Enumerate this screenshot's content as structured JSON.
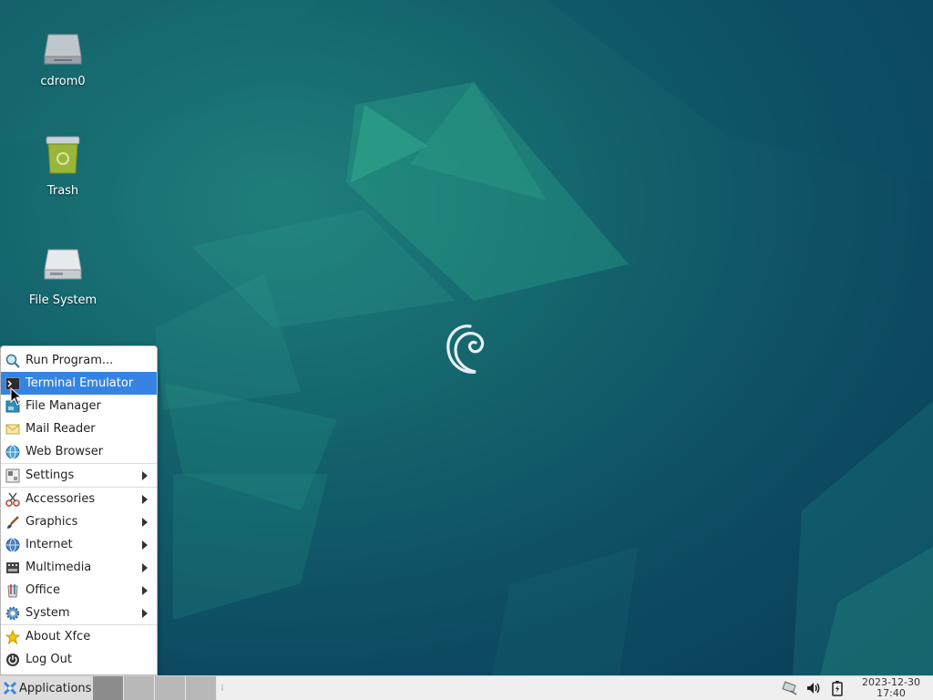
{
  "desktop": {
    "icons": [
      {
        "label": "cdrom0",
        "icon": "cdrom-icon"
      },
      {
        "label": "Trash",
        "icon": "trash-icon"
      },
      {
        "label": "File System",
        "icon": "harddisk-icon"
      }
    ]
  },
  "menu": {
    "items": [
      {
        "label": "Run Program...",
        "icon": "search-icon"
      },
      {
        "label": "Terminal Emulator",
        "icon": "terminal-icon"
      },
      {
        "label": "File Manager",
        "icon": "folder-icon"
      },
      {
        "label": "Mail Reader",
        "icon": "mail-icon"
      },
      {
        "label": "Web Browser",
        "icon": "globe-icon"
      },
      {
        "label": "Settings",
        "icon": "settings-icon"
      },
      {
        "label": "Accessories",
        "icon": "scissors-icon"
      },
      {
        "label": "Graphics",
        "icon": "brush-icon"
      },
      {
        "label": "Internet",
        "icon": "globe-icon"
      },
      {
        "label": "Multimedia",
        "icon": "film-icon"
      },
      {
        "label": "Office",
        "icon": "office-icon"
      },
      {
        "label": "System",
        "icon": "gear-icon"
      },
      {
        "label": "About Xfce",
        "icon": "star-icon"
      },
      {
        "label": "Log Out",
        "icon": "logout-icon"
      }
    ],
    "active_item": "Terminal Emulator"
  },
  "panel": {
    "applications_label": "Applications",
    "workspaces": 4,
    "active_workspace": 1,
    "clock": {
      "date": "2023-12-30",
      "time": "17:40"
    },
    "tray": [
      "network-icon",
      "volume-icon",
      "battery-icon"
    ]
  },
  "colors": {
    "accent": "#3584e4",
    "desktop_base": "#0d4a62",
    "panel_bg": "#efefef"
  }
}
